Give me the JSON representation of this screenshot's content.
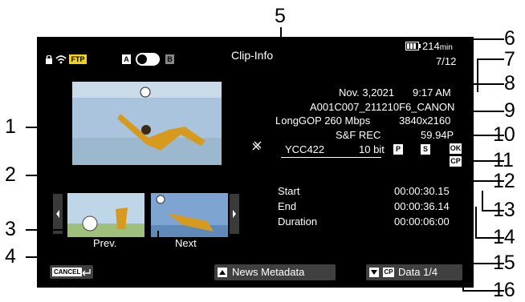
{
  "header": {
    "title": "Clip-Info",
    "battery_time": "214",
    "battery_unit": "min",
    "clip_counter": "7/12"
  },
  "status_icons": {
    "ftp_label": "FTP",
    "slot_a": "A",
    "slot_b": "B"
  },
  "clip": {
    "date": "Nov. 3,2021",
    "time": "9:17 AM",
    "clip_name": "A001C007_211210F6_CANON",
    "codec": "LongGOP 260 Mbps",
    "resolution": "3840x2160",
    "mode": "S&F REC",
    "frame_rate": "59.94P",
    "color": "YCC422",
    "bit_depth": "10 bit",
    "badges": {
      "p": "P",
      "s": "S",
      "ok": "OK",
      "cp": "CP"
    }
  },
  "timecodes": [
    {
      "label": "Start",
      "value": "00:00:30.15"
    },
    {
      "label": "End",
      "value": "00:00:36.14"
    },
    {
      "label": "Duration",
      "value": "00:00:06:00"
    }
  ],
  "thumbs": {
    "prev": "Prev.",
    "next": "Next"
  },
  "buttons": {
    "cancel": "CANCEL",
    "news": "News Metadata",
    "data_page": "Data 1/4",
    "cp": "CP"
  },
  "callouts": [
    "1",
    "2",
    "3",
    "4",
    "5",
    "6",
    "7",
    "8",
    "9",
    "10",
    "11",
    "12",
    "13",
    "14",
    "15",
    "16"
  ]
}
